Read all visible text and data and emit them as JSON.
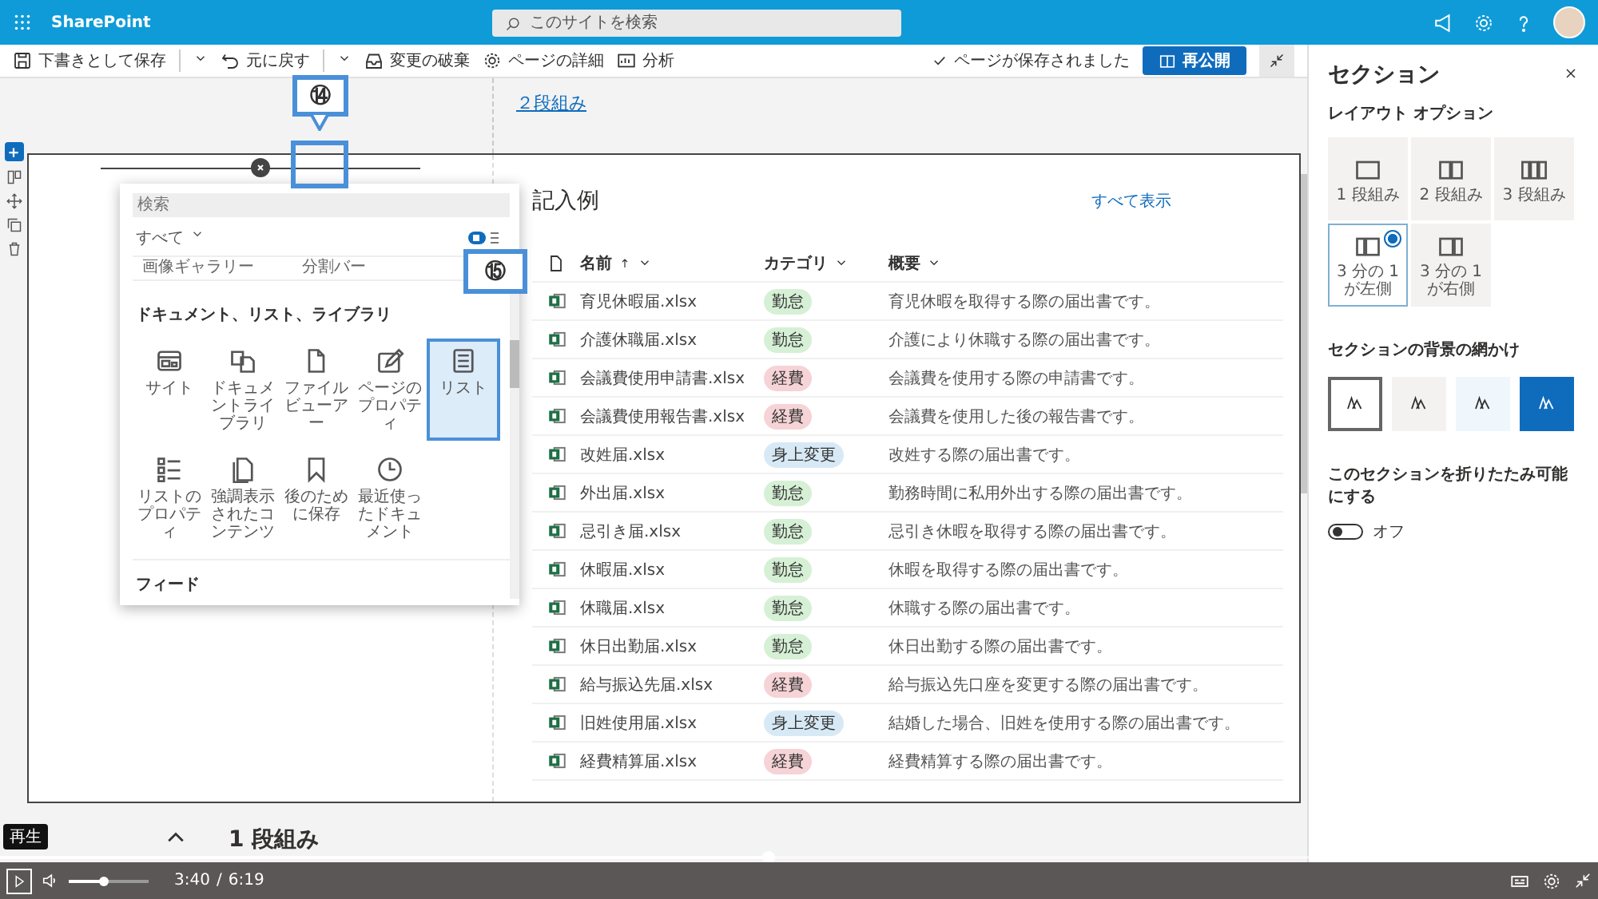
{
  "topbar": {
    "app_name": "SharePoint",
    "search": {
      "placeholder": "このサイトを検索"
    }
  },
  "commandbar": {
    "items": [
      {
        "label": "下書きとして保存",
        "kind": "save",
        "menu": true
      },
      {
        "label": "元に戻す",
        "kind": "undo",
        "menu": true
      },
      {
        "label": "変更の破棄",
        "kind": "discard",
        "menu": false
      },
      {
        "label": "ページの詳細",
        "kind": "details",
        "menu": false
      },
      {
        "label": "分析",
        "kind": "analytics",
        "menu": false
      }
    ],
    "status": "ページが保存されました",
    "publish_button": "再公開"
  },
  "canvas": {
    "top_section_link": "２段組み",
    "bottom_section_title": "1 段組み",
    "webpart": {
      "title": "記入例",
      "see_all": "すべて表示",
      "columns": [
        {
          "label": "名前",
          "sorted": true
        },
        {
          "label": "カテゴリ",
          "sorted": false
        },
        {
          "label": "概要",
          "sorted": false
        }
      ],
      "rows": [
        {
          "name": "育児休暇届.xlsx",
          "category": "勤怠",
          "color": "#d6f0d6",
          "summary": "育児休暇を取得する際の届出書です。"
        },
        {
          "name": "介護休職届.xlsx",
          "category": "勤怠",
          "color": "#d6f0d6",
          "summary": "介護により休職する際の届出書です。"
        },
        {
          "name": "会議費使用申請書.xlsx",
          "category": "経費",
          "color": "#f6d3d6",
          "summary": "会議費を使用する際の申請書です。"
        },
        {
          "name": "会議費使用報告書.xlsx",
          "category": "経費",
          "color": "#f6d3d6",
          "summary": "会議費を使用した後の報告書です。"
        },
        {
          "name": "改姓届.xlsx",
          "category": "身上変更",
          "color": "#d8e9f6",
          "summary": "改姓する際の届出書です。"
        },
        {
          "name": "外出届.xlsx",
          "category": "勤怠",
          "color": "#d6f0d6",
          "summary": "勤務時間に私用外出する際の届出書です。"
        },
        {
          "name": "忌引き届.xlsx",
          "category": "勤怠",
          "color": "#d6f0d6",
          "summary": "忌引き休暇を取得する際の届出書です。"
        },
        {
          "name": "休暇届.xlsx",
          "category": "勤怠",
          "color": "#d6f0d6",
          "summary": "休暇を取得する際の届出書です。"
        },
        {
          "name": "休職届.xlsx",
          "category": "勤怠",
          "color": "#d6f0d6",
          "summary": "休職する際の届出書です。"
        },
        {
          "name": "休日出勤届.xlsx",
          "category": "勤怠",
          "color": "#d6f0d6",
          "summary": "休日出勤する際の届出書です。"
        },
        {
          "name": "給与振込先届.xlsx",
          "category": "経費",
          "color": "#f6d3d6",
          "summary": "給与振込先口座を変更する際の届出書です。"
        },
        {
          "name": "旧姓使用届.xlsx",
          "category": "身上変更",
          "color": "#d8e9f6",
          "summary": "結婚した場合、旧姓を使用する際の届出書です。"
        },
        {
          "name": "経費精算届.xlsx",
          "category": "経費",
          "color": "#f6d3d6",
          "summary": "経費精算する際の届出書です。"
        }
      ]
    }
  },
  "picker": {
    "search_placeholder": "検索",
    "filter": "すべて",
    "cut_items": [
      "画像ギャラリー",
      "分割バー"
    ],
    "group_title": "ドキュメント、リスト、ライブラリ",
    "items": [
      {
        "label": "サイト",
        "kind": "site",
        "selected": false
      },
      {
        "label": "ドキュメントライブラリ",
        "kind": "library",
        "selected": false
      },
      {
        "label": "ファイルビューアー",
        "kind": "file",
        "selected": false
      },
      {
        "label": "ページのプロパティ",
        "kind": "pageprops",
        "selected": false
      },
      {
        "label": "リスト",
        "kind": "list",
        "selected": true
      },
      {
        "label": "リストのプロパティ",
        "kind": "listprops",
        "selected": false
      },
      {
        "label": "強調表示されたコンテンツ",
        "kind": "highlighted",
        "selected": false
      },
      {
        "label": "後のために保存",
        "kind": "saved",
        "selected": false
      },
      {
        "label": "最近使ったドキュメント",
        "kind": "recent",
        "selected": false
      }
    ],
    "next_group": "フィード"
  },
  "callouts": [
    {
      "number": "⑭"
    },
    {
      "number": "⑮"
    }
  ],
  "panel": {
    "title": "セクション",
    "layout_heading": "レイアウト オプション",
    "layouts": [
      {
        "label": "1 段組み",
        "kind": "one",
        "selected": false
      },
      {
        "label": "2 段組み",
        "kind": "two",
        "selected": false
      },
      {
        "label": "3 段組み",
        "kind": "three",
        "selected": false
      },
      {
        "label": "3 分の 1 が左側",
        "kind": "left",
        "selected": true
      },
      {
        "label": "3 分の 1 が右側",
        "kind": "right",
        "selected": false
      }
    ],
    "shading_heading": "セクションの背景の網かけ",
    "shadings": [
      {
        "kind": "none",
        "selected": true
      },
      {
        "kind": "neutral",
        "selected": false
      },
      {
        "kind": "soft",
        "selected": false
      },
      {
        "kind": "strong",
        "selected": false
      }
    ],
    "collapsible": {
      "label": "このセクションを折りたたみ可能にする",
      "on": false,
      "state_label": "オフ"
    }
  },
  "player": {
    "tooltip": "再生",
    "current": "3:40",
    "separator": "/",
    "duration": "6:19",
    "progress": {
      "level": 0.58
    },
    "volume": {
      "level": 0.43
    }
  }
}
